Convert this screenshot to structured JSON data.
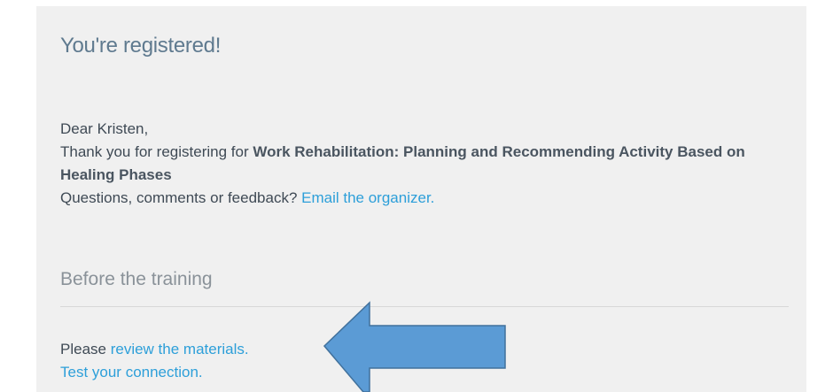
{
  "email": {
    "title": "You're registered!",
    "greeting": "Dear Kristen,",
    "thanks_prefix": "Thank you for registering for ",
    "event_name": "Work Rehabilitation: Planning and Recommending Activity Based on Healing Phases",
    "questions_prefix": "Questions, comments or feedback? ",
    "organizer_link": "Email the organizer."
  },
  "before_training": {
    "heading": "Before the training",
    "materials_prefix": "Please ",
    "materials_link": "review the materials.",
    "connection_link": "Test your connection."
  },
  "colors": {
    "card_background": "#f0f0f0",
    "title": "#5f7a8f",
    "link": "#2d9fd9",
    "arrow_fill": "#5b9bd5",
    "arrow_stroke": "#41719c"
  },
  "annotation": {
    "icon": "left-arrow-icon"
  }
}
